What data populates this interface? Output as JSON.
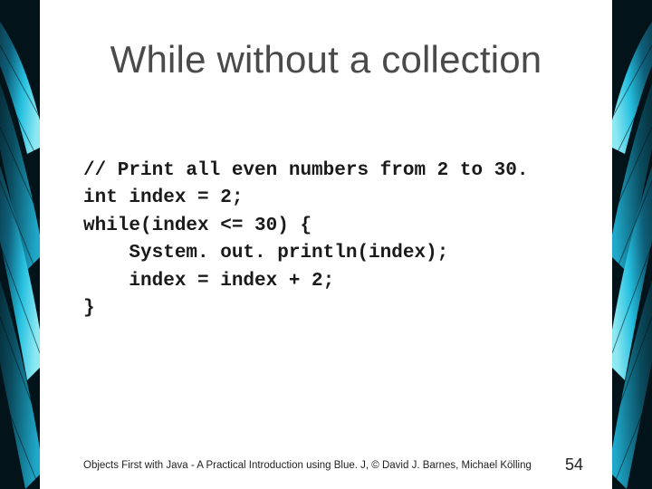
{
  "slide": {
    "title": "While without a collection",
    "code": "// Print all even numbers from 2 to 30.\nint index = 2;\nwhile(index <= 30) {\n    System. out. println(index);\n    index = index + 2;\n}",
    "footer": "Objects First with Java - A Practical Introduction using Blue. J, © David J. Barnes, Michael Kölling",
    "page_number": "54"
  }
}
